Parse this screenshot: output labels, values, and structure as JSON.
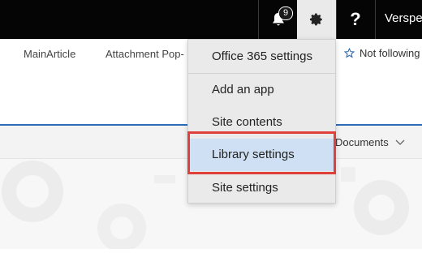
{
  "suite_bar": {
    "notification_count": "9",
    "help_label": "?",
    "user_name": "Verspe"
  },
  "top_nav": {
    "links": [
      "MainArticle",
      "Attachment Pop-"
    ],
    "follow_label": "Not following"
  },
  "command_bar": {
    "documents_label": "Documents"
  },
  "settings_menu": {
    "items": [
      {
        "label": "Office 365 settings"
      },
      {
        "label": "Add an app"
      },
      {
        "label": "Site contents"
      },
      {
        "label": "Library settings",
        "highlighted": true
      },
      {
        "label": "Site settings"
      }
    ]
  },
  "colors": {
    "suite_bar": "#050505",
    "accent_line": "#2b6cb5",
    "menu_highlight": "#cfe0f4",
    "annotation_box": "#e0403a"
  }
}
